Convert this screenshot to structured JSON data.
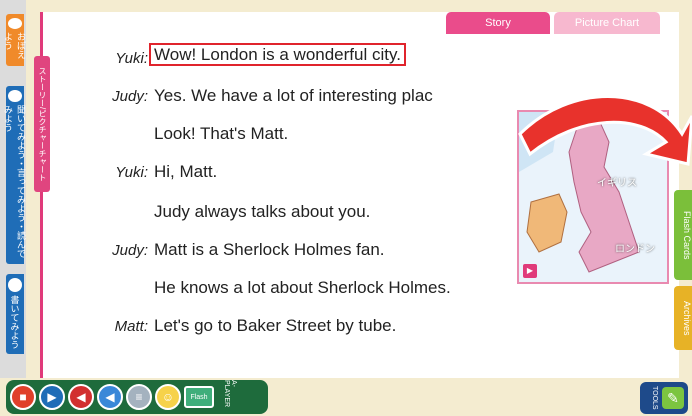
{
  "left_tabs": [
    {
      "label": "おぼえよう"
    },
    {
      "label": "聞いてみよう・言ってみよう・読んでみよう"
    },
    {
      "label": "書いてみよう"
    }
  ],
  "pink_strip": {
    "label": "ストーリー/ピクチャーチャート"
  },
  "tabs": [
    {
      "label": "Story",
      "active": true
    },
    {
      "label": "Picture Chart",
      "active": false
    }
  ],
  "dialogue": [
    {
      "speaker": "Yuki:",
      "text": "Wow!  London is a wonderful city.",
      "highlight": true
    },
    {
      "speaker": "Judy:",
      "text": "Yes.  We have a lot of interesting plac"
    },
    {
      "speaker": "",
      "text": "Look!  That's Matt."
    },
    {
      "speaker": "Yuki:",
      "text": "Hi, Matt."
    },
    {
      "speaker": "",
      "text": "Judy always talks about you."
    },
    {
      "speaker": "Judy:",
      "text": "Matt is a Sherlock Holmes fan."
    },
    {
      "speaker": "",
      "text": "He knows a lot about Sherlock Holmes."
    },
    {
      "speaker": "Matt:",
      "text": "Let's go to Baker Street by tube."
    }
  ],
  "map": {
    "country_label": "イギリス",
    "city_label": "ロンドン"
  },
  "right_tabs": [
    {
      "label": "Flash Cards"
    },
    {
      "label": "Archives"
    }
  ],
  "player": {
    "label": "A-PLAYER",
    "card_label": "Flash"
  },
  "tools": {
    "label": "TOOLS"
  },
  "colors": {
    "accent": "#ea4c8b",
    "highlight": "#e0242c",
    "player": "#1e6b3c"
  }
}
